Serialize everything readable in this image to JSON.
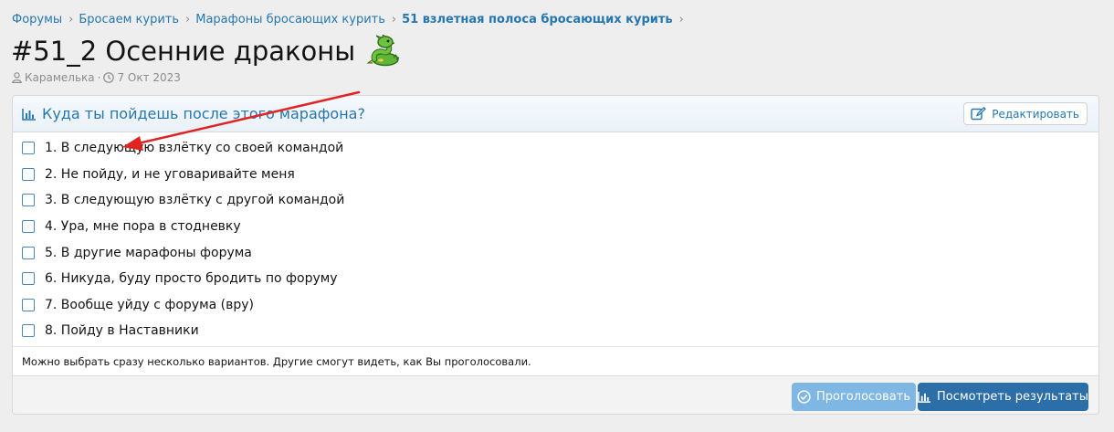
{
  "breadcrumb": {
    "items": [
      "Форумы",
      "Бросаем курить",
      "Марафоны бросающих курить",
      "51 взлетная полоса бросающих курить"
    ]
  },
  "thread": {
    "title": "#51_2 Осенние драконы",
    "title_icon": "dragon-emoji",
    "author": "Карамелька",
    "separator": "·",
    "date": "7 Окт 2023"
  },
  "poll": {
    "question": "Куда ты пойдешь после этого марафона?",
    "edit_label": "Редактировать",
    "options": [
      "1. В следующую взлётку со своей командой",
      "2. Не пойду, и не уговаривайте меня",
      "3. В следующую взлётку с другой командой",
      "4. Ура, мне пора в стодневку",
      "5. В другие марафоны форума",
      "6. Никуда, буду просто бродить по форуму",
      "7. Вообще уйду с форума (вру)",
      "8. Пойду в Наставники"
    ],
    "hint": "Можно выбрать сразу несколько вариантов. Другие смогут видеть, как Вы проголосовали.",
    "vote_label": "Проголосовать",
    "results_label": "Посмотреть результаты"
  },
  "colors": {
    "link": "#2577b1",
    "vote_button": "#7eb6e4",
    "results_button": "#2c6fa8",
    "annotation_arrow": "#e02424"
  }
}
